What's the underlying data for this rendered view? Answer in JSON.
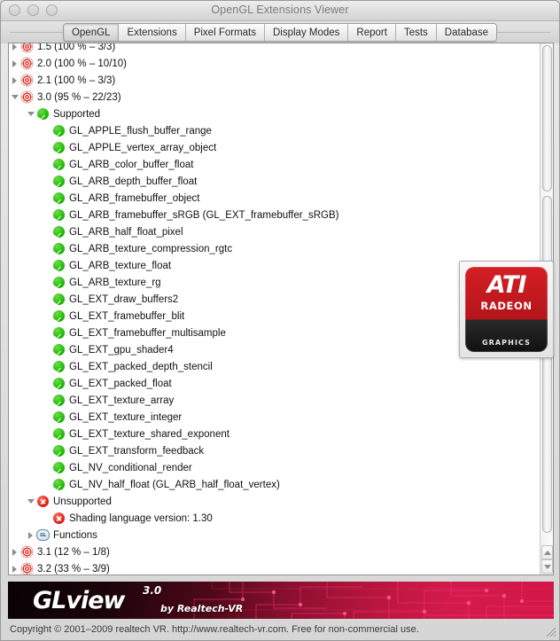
{
  "window": {
    "title": "OpenGL Extensions Viewer",
    "traffic_lights": [
      "close",
      "minimize",
      "zoom"
    ]
  },
  "tabs": [
    {
      "label": "OpenGL",
      "active": true
    },
    {
      "label": "Extensions",
      "active": false
    },
    {
      "label": "Pixel Formats",
      "active": false
    },
    {
      "label": "Display Modes",
      "active": false
    },
    {
      "label": "Report",
      "active": false
    },
    {
      "label": "Tests",
      "active": false
    },
    {
      "label": "Database",
      "active": false
    }
  ],
  "tree": [
    {
      "label": "1.5 (100 % – 3/3)",
      "icon": "target",
      "twisty": "right",
      "indent": 0
    },
    {
      "label": "2.0 (100 % – 10/10)",
      "icon": "target",
      "twisty": "right",
      "indent": 0
    },
    {
      "label": "2.1 (100 % – 3/3)",
      "icon": "target",
      "twisty": "right",
      "indent": 0
    },
    {
      "label": "3.0 (95 % – 22/23)",
      "icon": "target",
      "twisty": "down",
      "indent": 0
    },
    {
      "label": "Supported",
      "icon": "check",
      "twisty": "down",
      "indent": 1
    },
    {
      "label": "GL_APPLE_flush_buffer_range",
      "icon": "check",
      "twisty": "none",
      "indent": 2
    },
    {
      "label": "GL_APPLE_vertex_array_object",
      "icon": "check",
      "twisty": "none",
      "indent": 2
    },
    {
      "label": "GL_ARB_color_buffer_float",
      "icon": "check",
      "twisty": "none",
      "indent": 2
    },
    {
      "label": "GL_ARB_depth_buffer_float",
      "icon": "check",
      "twisty": "none",
      "indent": 2
    },
    {
      "label": "GL_ARB_framebuffer_object",
      "icon": "check",
      "twisty": "none",
      "indent": 2
    },
    {
      "label": "GL_ARB_framebuffer_sRGB (GL_EXT_framebuffer_sRGB)",
      "icon": "check",
      "twisty": "none",
      "indent": 2
    },
    {
      "label": "GL_ARB_half_float_pixel",
      "icon": "check",
      "twisty": "none",
      "indent": 2
    },
    {
      "label": "GL_ARB_texture_compression_rgtc",
      "icon": "check",
      "twisty": "none",
      "indent": 2
    },
    {
      "label": "GL_ARB_texture_float",
      "icon": "check",
      "twisty": "none",
      "indent": 2
    },
    {
      "label": "GL_ARB_texture_rg",
      "icon": "check",
      "twisty": "none",
      "indent": 2
    },
    {
      "label": "GL_EXT_draw_buffers2",
      "icon": "check",
      "twisty": "none",
      "indent": 2
    },
    {
      "label": "GL_EXT_framebuffer_blit",
      "icon": "check",
      "twisty": "none",
      "indent": 2
    },
    {
      "label": "GL_EXT_framebuffer_multisample",
      "icon": "check",
      "twisty": "none",
      "indent": 2
    },
    {
      "label": "GL_EXT_gpu_shader4",
      "icon": "check",
      "twisty": "none",
      "indent": 2
    },
    {
      "label": "GL_EXT_packed_depth_stencil",
      "icon": "check",
      "twisty": "none",
      "indent": 2
    },
    {
      "label": "GL_EXT_packed_float",
      "icon": "check",
      "twisty": "none",
      "indent": 2
    },
    {
      "label": "GL_EXT_texture_array",
      "icon": "check",
      "twisty": "none",
      "indent": 2
    },
    {
      "label": "GL_EXT_texture_integer",
      "icon": "check",
      "twisty": "none",
      "indent": 2
    },
    {
      "label": "GL_EXT_texture_shared_exponent",
      "icon": "check",
      "twisty": "none",
      "indent": 2
    },
    {
      "label": "GL_EXT_transform_feedback",
      "icon": "check",
      "twisty": "none",
      "indent": 2
    },
    {
      "label": "GL_NV_conditional_render",
      "icon": "check",
      "twisty": "none",
      "indent": 2
    },
    {
      "label": "GL_NV_half_float (GL_ARB_half_float_vertex)",
      "icon": "check",
      "twisty": "none",
      "indent": 2
    },
    {
      "label": "Unsupported",
      "icon": "x",
      "twisty": "down",
      "indent": 1
    },
    {
      "label": "Shading language version: 1.30",
      "icon": "x",
      "twisty": "none",
      "indent": 2
    },
    {
      "label": "Functions",
      "icon": "functions",
      "twisty": "right",
      "indent": 1
    },
    {
      "label": "3.1 (12 % – 1/8)",
      "icon": "target",
      "twisty": "right",
      "indent": 0
    },
    {
      "label": "3.2 (33 % – 3/9)",
      "icon": "target",
      "twisty": "right",
      "indent": 0
    }
  ],
  "gpu_badge": {
    "brand": "ATI",
    "family": "RADEON",
    "category": "GRAPHICS",
    "accent_color": "#c8161d"
  },
  "banner": {
    "product": "GLview",
    "version": "3.0",
    "byline": "by Realtech-VR",
    "accent_color": "#c2123a"
  },
  "footer": {
    "copyright": "Copyright © 2001–2009 realtech VR. http://www.realtech-vr.com. Free for non-commercial use."
  },
  "scrollbar": {
    "orientation": "vertical",
    "up_arrow": "▲",
    "down_arrow": "▼"
  }
}
